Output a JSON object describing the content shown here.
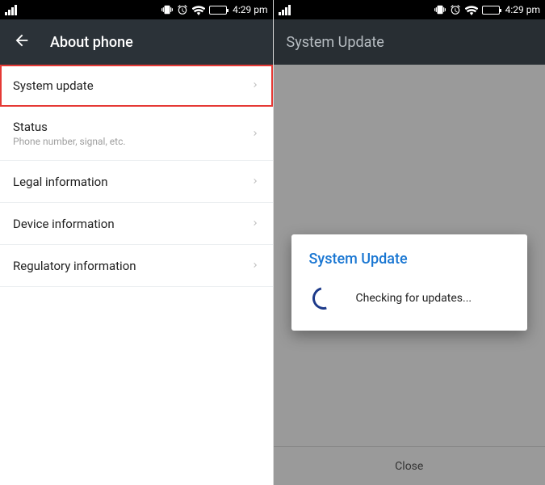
{
  "status": {
    "time": "4:29 pm"
  },
  "left": {
    "title": "About phone",
    "items": [
      {
        "title": "System update",
        "sub": ""
      },
      {
        "title": "Status",
        "sub": "Phone number, signal, etc."
      },
      {
        "title": "Legal information",
        "sub": ""
      },
      {
        "title": "Device information",
        "sub": ""
      },
      {
        "title": "Regulatory information",
        "sub": ""
      }
    ]
  },
  "right": {
    "title": "System Update",
    "dialog": {
      "title": "System Update",
      "message": "Checking for updates..."
    },
    "close_label": "Close"
  }
}
